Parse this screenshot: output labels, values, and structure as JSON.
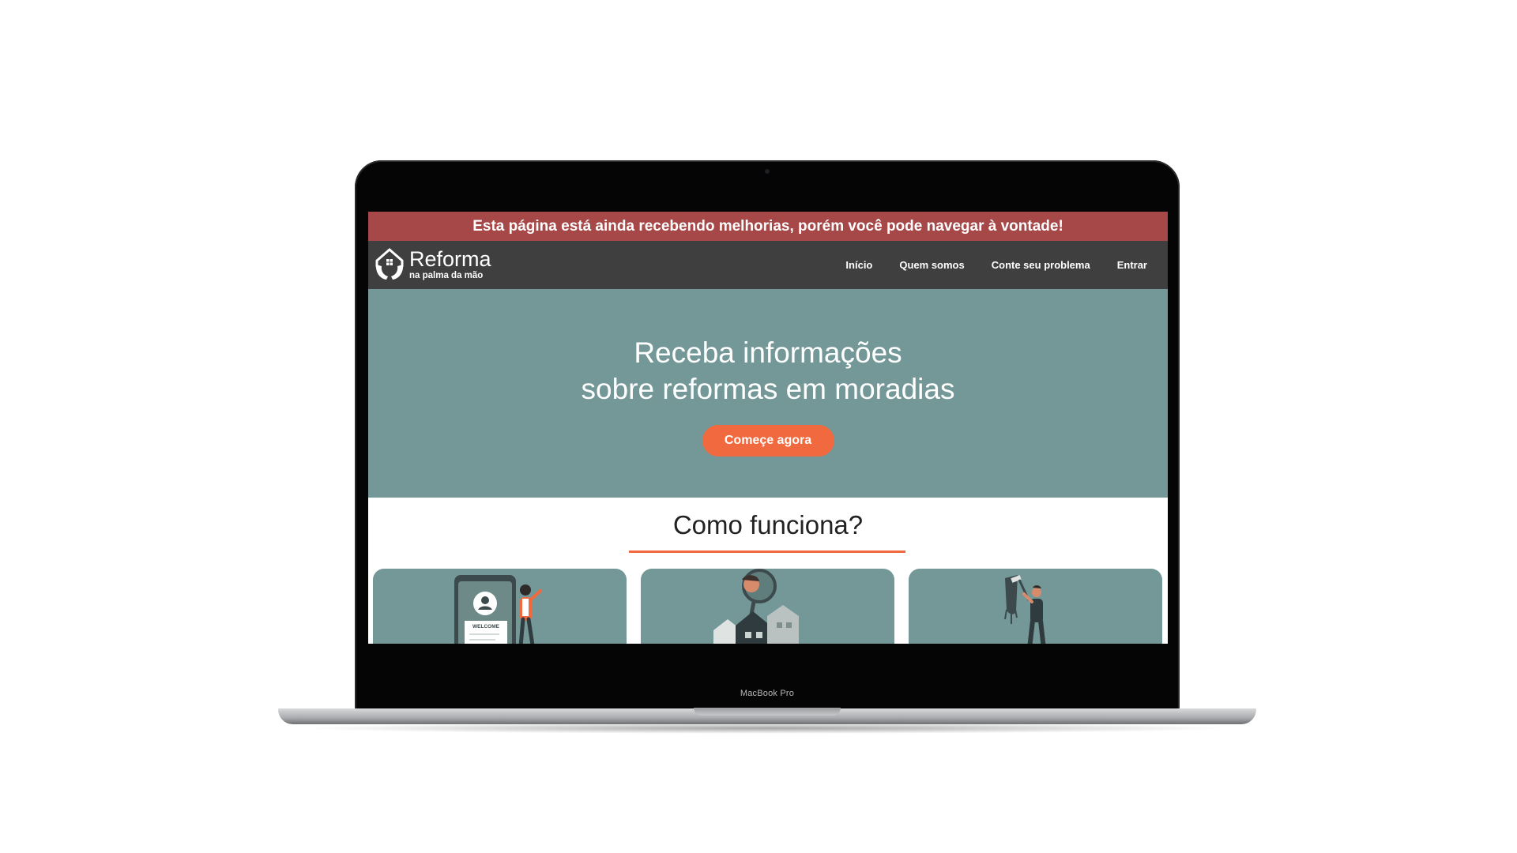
{
  "device": {
    "model_label": "MacBook Pro"
  },
  "notice": {
    "text": "Esta página está ainda recebendo melhorias, porém você pode navegar à vontade!"
  },
  "brand": {
    "name": "Reforma",
    "tagline": "na palma da mão",
    "icon": "house-hands-icon"
  },
  "nav": {
    "items": [
      {
        "label": "Início"
      },
      {
        "label": "Quem somos"
      },
      {
        "label": "Conte seu problema"
      },
      {
        "label": "Entrar"
      }
    ]
  },
  "hero": {
    "title_line1": "Receba informações",
    "title_line2": "sobre reformas em moradias",
    "cta_label": "Começe agora"
  },
  "how_it_works": {
    "title": "Como funciona?",
    "cards": [
      {
        "illustration": "phone-welcome-illustration",
        "welcome_text": "WELCOME"
      },
      {
        "illustration": "house-search-illustration"
      },
      {
        "illustration": "painter-illustration"
      }
    ]
  },
  "colors": {
    "notice_bg": "#a64848",
    "navbar_bg": "#3f3f3f",
    "hero_bg": "#739897",
    "accent": "#f1693f"
  }
}
